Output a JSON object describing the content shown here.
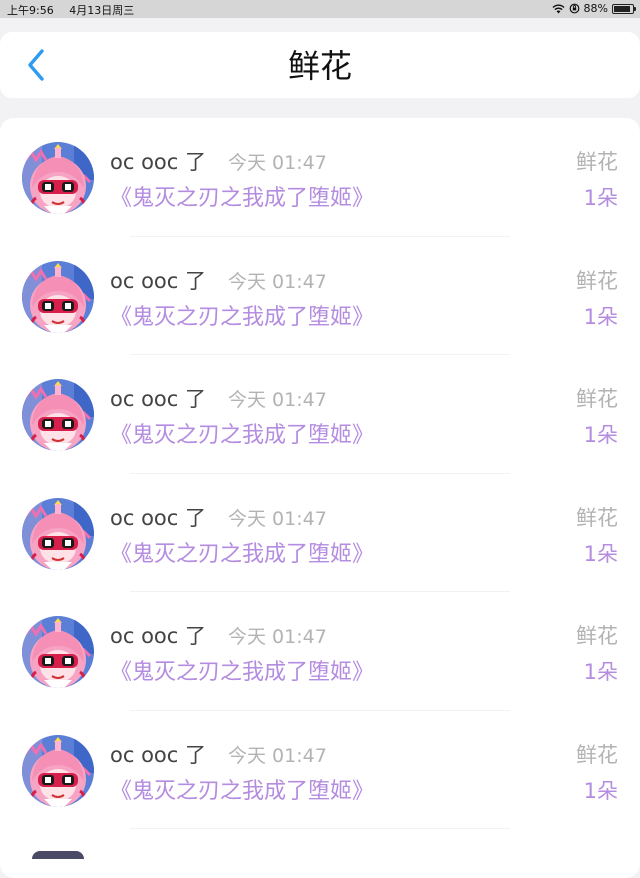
{
  "status_bar": {
    "time": "上午9:56",
    "date": "4月13日周三",
    "battery": "88%",
    "battery_level": 0.88,
    "wifi_icon": "wifi-icon",
    "lock_icon": "orientation-lock-icon"
  },
  "header": {
    "title": "鲜花",
    "back_icon": "chevron-left-icon",
    "accent_color": "#2d9cf0"
  },
  "colors": {
    "purple": "#b48ce0",
    "gray": "#b3b3b3",
    "name": "#444444"
  },
  "list": {
    "items": [
      {
        "username": "oc ooc 了",
        "time": "今天 01:47",
        "book": "《鬼灭之刃之我成了堕姬》",
        "gift_type": "鲜花",
        "gift_count": "1朵"
      },
      {
        "username": "oc ooc 了",
        "time": "今天 01:47",
        "book": "《鬼灭之刃之我成了堕姬》",
        "gift_type": "鲜花",
        "gift_count": "1朵"
      },
      {
        "username": "oc ooc 了",
        "time": "今天 01:47",
        "book": "《鬼灭之刃之我成了堕姬》",
        "gift_type": "鲜花",
        "gift_count": "1朵"
      },
      {
        "username": "oc ooc 了",
        "time": "今天 01:47",
        "book": "《鬼灭之刃之我成了堕姬》",
        "gift_type": "鲜花",
        "gift_count": "1朵"
      },
      {
        "username": "oc ooc 了",
        "time": "今天 01:47",
        "book": "《鬼灭之刃之我成了堕姬》",
        "gift_type": "鲜花",
        "gift_count": "1朵"
      },
      {
        "username": "oc ooc 了",
        "time": "今天 01:47",
        "book": "《鬼灭之刃之我成了堕姬》",
        "gift_type": "鲜花",
        "gift_count": "1朵"
      }
    ]
  }
}
